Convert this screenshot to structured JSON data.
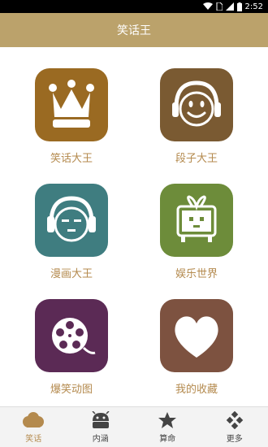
{
  "status_bar": {
    "time": "2:52"
  },
  "header": {
    "title": "笑话王"
  },
  "tiles": [
    {
      "label": "笑话大王",
      "icon": "crown-icon",
      "color": "#9a6a22"
    },
    {
      "label": "段子大王",
      "icon": "smiley-headphones-icon",
      "color": "#7a5a32"
    },
    {
      "label": "漫画大王",
      "icon": "face-headphones-icon",
      "color": "#3f7d80"
    },
    {
      "label": "娱乐世界",
      "icon": "tv-icon",
      "color": "#6d8c3a"
    },
    {
      "label": "爆笑动图",
      "icon": "film-reel-icon",
      "color": "#5b2a55"
    },
    {
      "label": "我的收藏",
      "icon": "heart-icon",
      "color": "#7d5240"
    }
  ],
  "bottom_nav": [
    {
      "label": "笑话",
      "icon": "cloud-icon",
      "active": true
    },
    {
      "label": "内涵",
      "icon": "android-icon",
      "active": false
    },
    {
      "label": "算命",
      "icon": "star-icon",
      "active": false
    },
    {
      "label": "更多",
      "icon": "grid-diamond-icon",
      "active": false
    }
  ],
  "colors": {
    "header_bg": "#bba26b",
    "label": "#b48a4e"
  }
}
